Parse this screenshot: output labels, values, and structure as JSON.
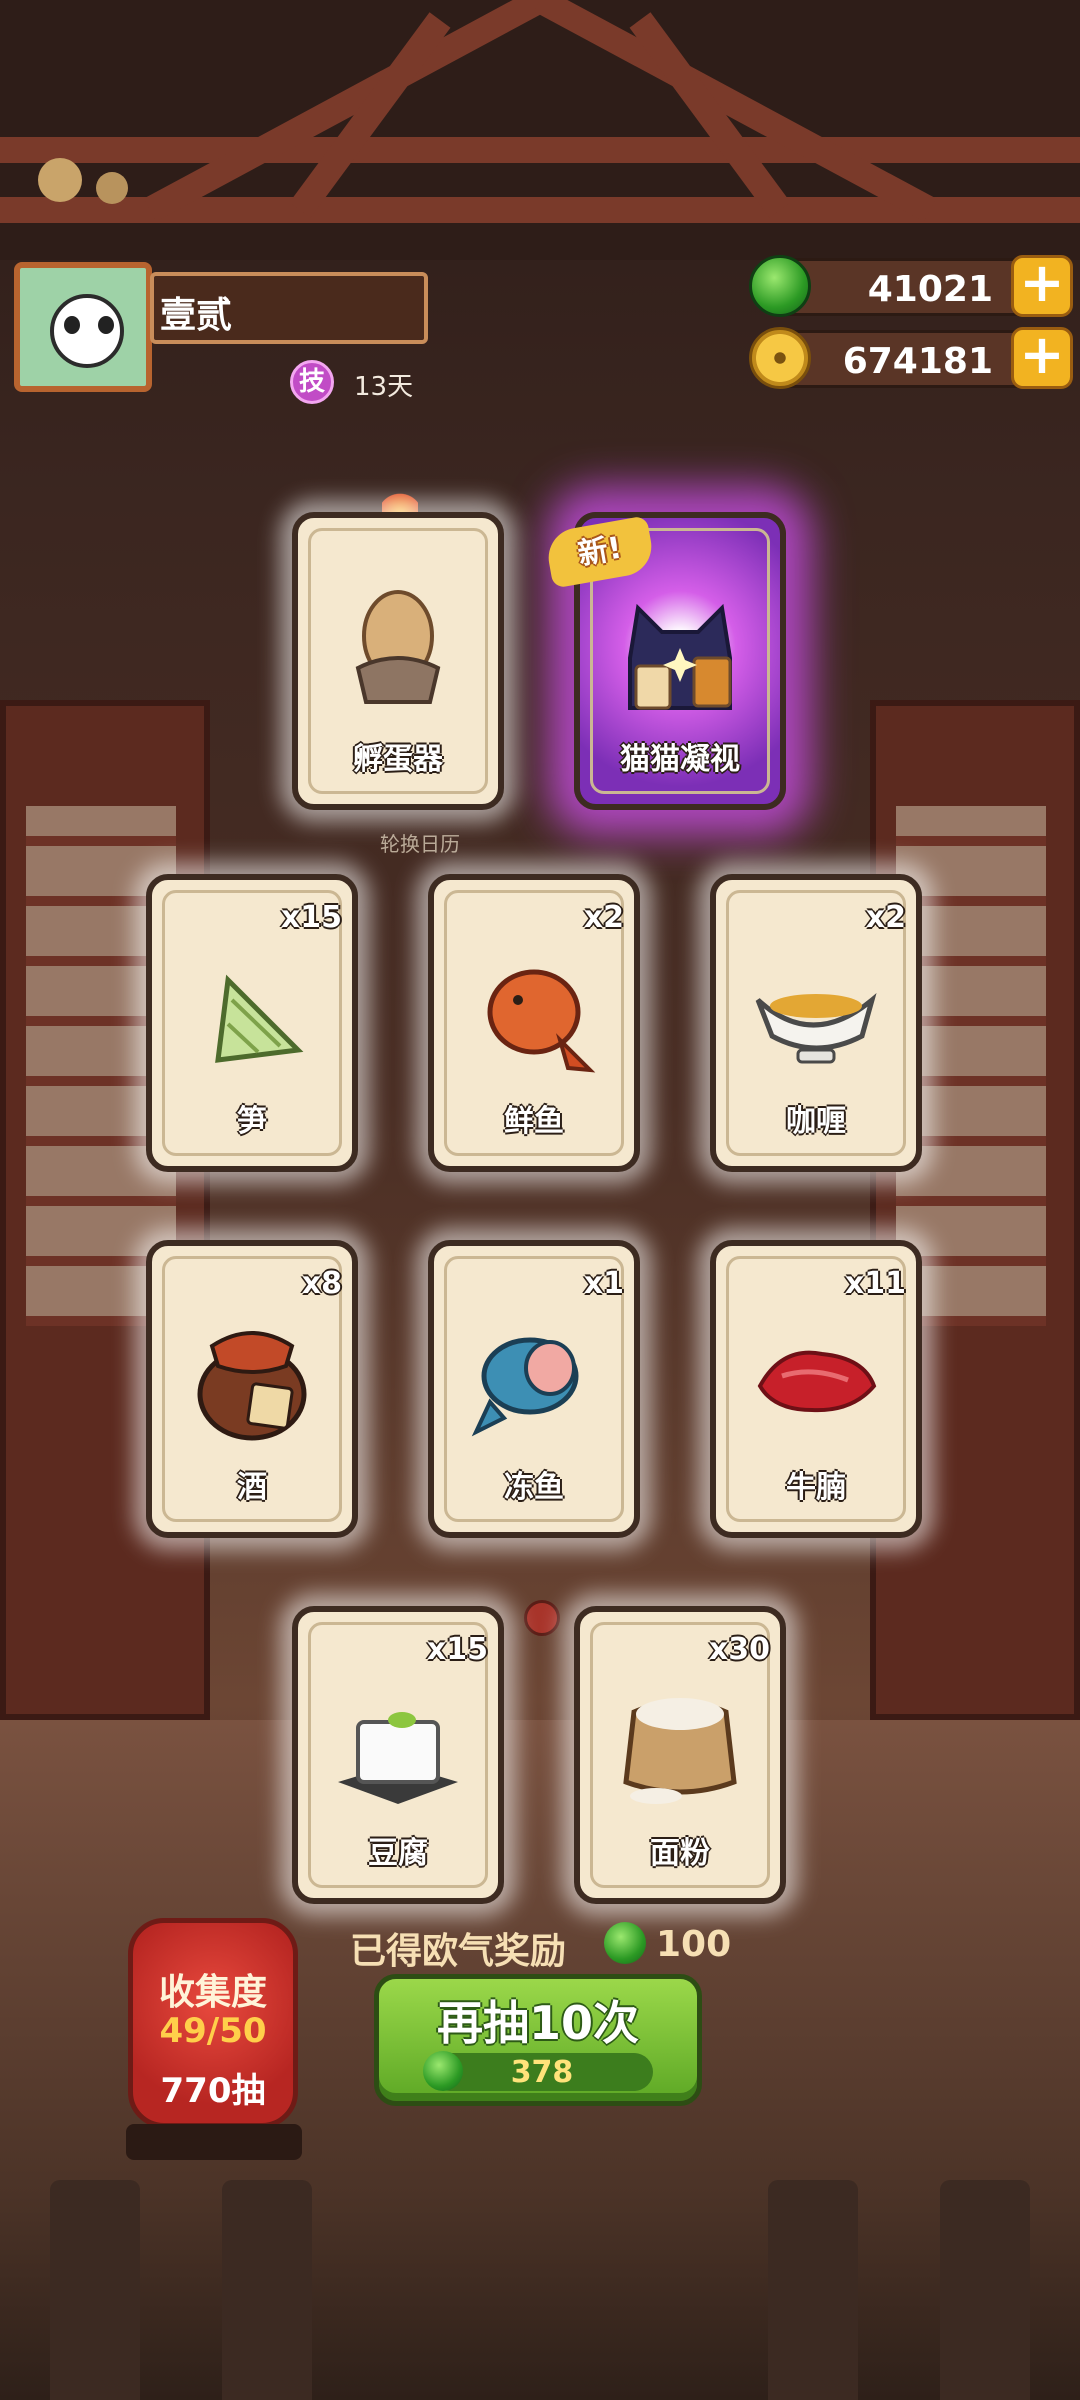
{
  "player": {
    "name": "壹贰",
    "skill_badge": "技",
    "days": "13天"
  },
  "currencies": {
    "jade": "41021",
    "coins": "674181"
  },
  "calendar_label": "轮换日历",
  "new_tag": "新!",
  "cards": [
    {
      "label": "孵蛋器",
      "count": "",
      "icon": "egg-incubator-icon"
    },
    {
      "label": "猫猫凝视",
      "count": "",
      "icon": "cat-gaze-icon"
    },
    {
      "label": "笋",
      "count": "x15",
      "icon": "bamboo-shoot-icon"
    },
    {
      "label": "鲜鱼",
      "count": "x2",
      "icon": "fresh-fish-icon"
    },
    {
      "label": "咖喱",
      "count": "x2",
      "icon": "curry-gravy-boat-icon"
    },
    {
      "label": "酒",
      "count": "x8",
      "icon": "wine-jar-icon"
    },
    {
      "label": "冻鱼",
      "count": "x1",
      "icon": "frozen-fish-icon"
    },
    {
      "label": "牛腩",
      "count": "x11",
      "icon": "beef-brisket-icon"
    },
    {
      "label": "豆腐",
      "count": "x15",
      "icon": "tofu-icon"
    },
    {
      "label": "面粉",
      "count": "x30",
      "icon": "flour-sack-icon"
    }
  ],
  "reward": {
    "label": "已得欧气奖励",
    "value": "100"
  },
  "collection": {
    "title": "收集度",
    "progress": "49/50",
    "draws": "770抽"
  },
  "draw_button": {
    "label": "再抽10次",
    "cost": "378"
  },
  "colors": {
    "accent_green": "#5da825",
    "gold": "#f2b321",
    "purple_glow": "#d45ee8"
  }
}
